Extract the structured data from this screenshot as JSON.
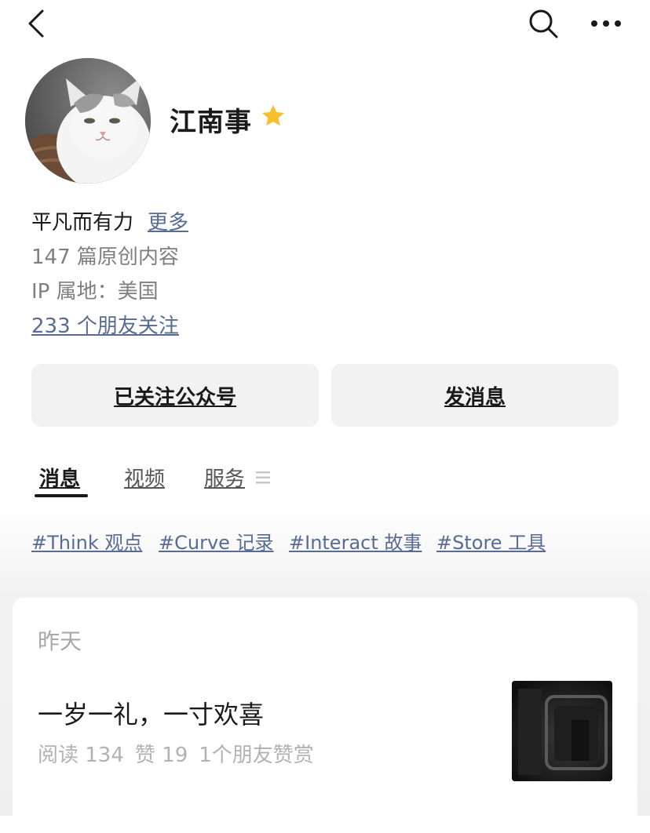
{
  "profile": {
    "name": "江南事",
    "bio": "平凡而有力",
    "more_link": "更多",
    "articles": "147 篇原创内容",
    "ip_location": "IP 属地：美国",
    "friends_following": "233 个朋友关注"
  },
  "buttons": {
    "followed": "已关注公众号",
    "message": "发消息"
  },
  "tabs": [
    {
      "label": "消息",
      "active": true
    },
    {
      "label": "视频",
      "active": false
    },
    {
      "label": "服务",
      "active": false
    }
  ],
  "tags": [
    "#Think 观点",
    "#Curve 记录",
    "#Interact 故事",
    "#Store 工具"
  ],
  "feed": {
    "date": "昨天",
    "article": {
      "title": "一岁一礼，一寸欢喜",
      "reads": "阅读 134",
      "likes": "赞 19",
      "rewards": "1个朋友赞赏"
    }
  },
  "colors": {
    "link": "#576b95",
    "star": "#f7c02c",
    "button_bg": "#f2f2f2"
  },
  "icons": [
    "back-arrow-icon",
    "search-icon",
    "more-dots-icon",
    "star-icon",
    "menu-lines-icon"
  ]
}
